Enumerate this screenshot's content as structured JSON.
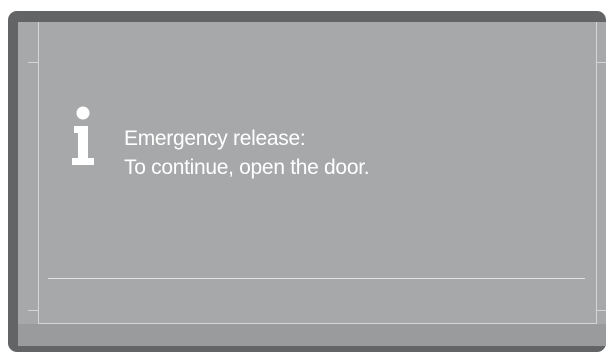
{
  "dialog": {
    "icon": "info-icon",
    "message_line1": "Emergency release:",
    "message_line2": "To continue, open the door."
  },
  "colors": {
    "bezel": "#636466",
    "screen": "#a7a8aa",
    "text": "#ffffff",
    "frame_lines": "#d4d5d7"
  }
}
